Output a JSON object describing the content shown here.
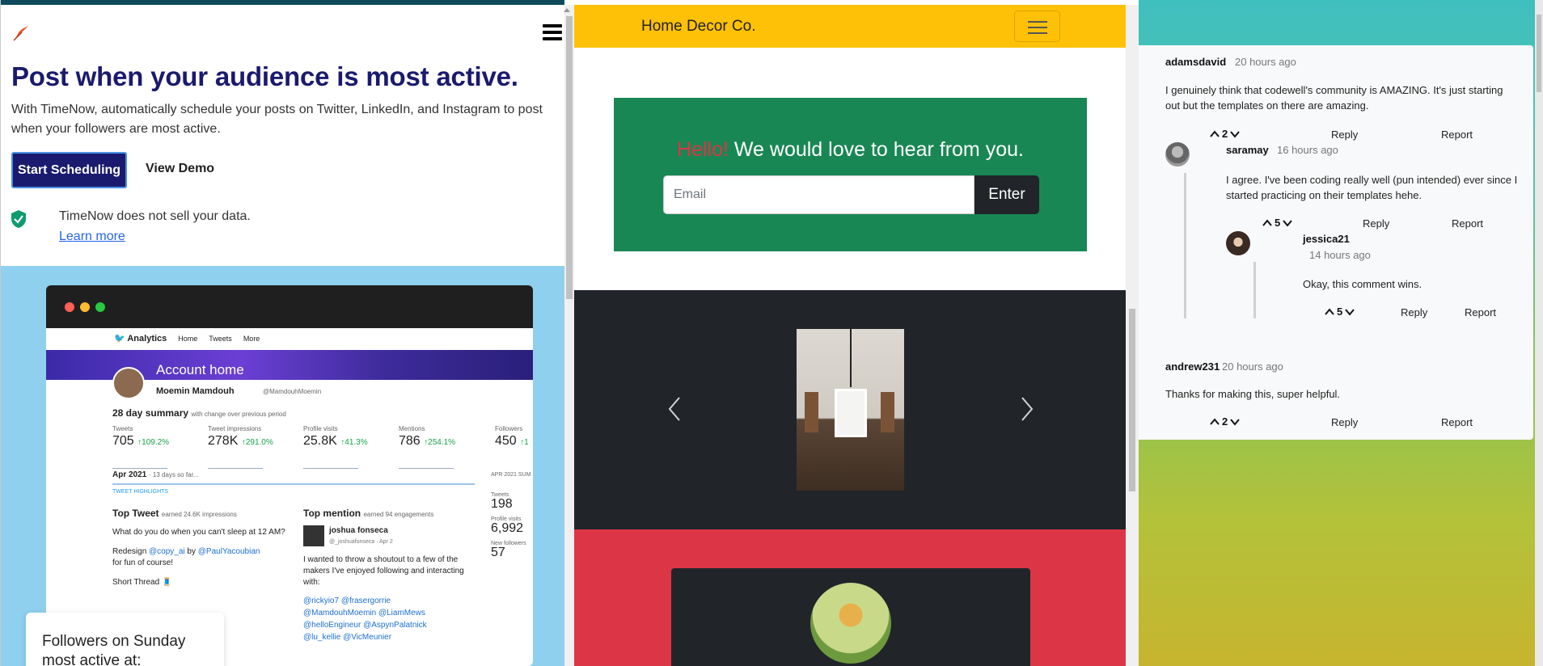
{
  "timenow": {
    "headline": "Post when your audience is most active.",
    "subtext": "With TimeNow, automatically schedule your posts on Twitter, LinkedIn, and Instagram to post when your followers are most active.",
    "start_button": "Start Scheduling",
    "demo_button": "View Demo",
    "privacy_text": "TimeNow does not sell your data.",
    "learn_more": "Learn more",
    "card_text": "Followers on Sunday most active at:",
    "analytics": {
      "brand": "Analytics",
      "nav": [
        "Home",
        "Tweets",
        "More"
      ],
      "header": "Account home",
      "name": "Moemin Mamdouh",
      "handle": "@MamdouhMoemin",
      "summary_title": "28 day summary",
      "summary_sub": "with change over previous period",
      "stats": [
        {
          "label": "Tweets",
          "value": "705",
          "change": "↑109.2%"
        },
        {
          "label": "Tweet impressions",
          "value": "278K",
          "change": "↑291.0%"
        },
        {
          "label": "Profile visits",
          "value": "25.8K",
          "change": "↑41.3%"
        },
        {
          "label": "Mentions",
          "value": "786",
          "change": "↑254.1%"
        },
        {
          "label": "Followers",
          "value": "450",
          "change": "↑1"
        }
      ],
      "month": "Apr 2021",
      "month_sub": "· 13 days so far...",
      "highlights": "TWEET HIGHLIGHTS",
      "top_tweet_title": "Top Tweet",
      "top_tweet_sub": "earned 24.6K impressions",
      "top_tweet_text": "What do you do when you can't sleep at 12 AM?",
      "top_tweet_line2_a": "Redesign ",
      "top_tweet_line2_b": "@copy_ai",
      "top_tweet_line2_c": " by ",
      "top_tweet_line2_d": "@PaulYacoubian",
      "top_tweet_line3": "for fun of course!",
      "top_tweet_line4": "Short Thread 🧵",
      "top_mention_title": "Top mention",
      "top_mention_sub": "earned 94 engagements",
      "mention_name": "joshua fonseca",
      "mention_handle": "@_joshuafonseca · Apr 2",
      "mention_text": "I wanted to throw a shoutout to a few of the makers I've enjoyed following and interacting with:",
      "mention_tags": "@rickyio7 @frasergorrie @MamdouhMoemin @LiamMews @helloEngineur @AspynPalatnick @lu_kellie @VicMeunier",
      "side_title": "APR 2021 SUM",
      "side": [
        {
          "label": "Tweets",
          "value": "198"
        },
        {
          "label": "Profile visits",
          "value": "6,992"
        },
        {
          "label": "New followers",
          "value": "57"
        }
      ]
    }
  },
  "homedecor": {
    "brand": "Home Decor Co.",
    "hello": "Hello!",
    "tagline": " We would love to hear from you.",
    "email_placeholder": "Email",
    "enter_button": "Enter"
  },
  "comments": [
    {
      "user": "adamsdavid",
      "time": "20 hours ago",
      "text": "I genuinely think that codewell's community is AMAZING. It's just starting out but the templates on there are amazing.",
      "votes": "2"
    },
    {
      "user": "saramay",
      "time": "16 hours ago",
      "text": "I agree. I've been coding really well (pun intended) ever since I started practicing on their templates hehe.",
      "votes": "5"
    },
    {
      "user": "jessica21",
      "time": "14 hours ago",
      "text": "Okay, this comment wins.",
      "votes": "5"
    },
    {
      "user": "andrew231",
      "time": "20 hours ago",
      "text": "Thanks for making this, super helpful.",
      "votes": "2"
    }
  ],
  "comment_actions": {
    "reply": "Reply",
    "report": "Report"
  },
  "colors": {
    "timenow_navy": "#1a1a6e",
    "timenow_sky": "#8fd0ef",
    "decor_yellow": "#ffc107",
    "decor_green": "#198754",
    "decor_dark": "#212529",
    "decor_red": "#dc3545"
  }
}
